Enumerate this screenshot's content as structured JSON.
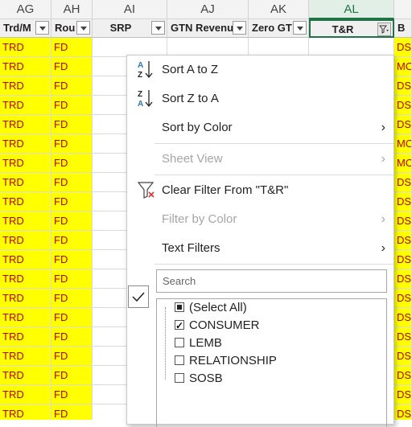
{
  "columns": [
    {
      "letter": "AG",
      "header": "Trd/M"
    },
    {
      "letter": "AH",
      "header": "Rou"
    },
    {
      "letter": "AI",
      "header": "SRP"
    },
    {
      "letter": "AJ",
      "header": "GTN Revenu"
    },
    {
      "letter": "AK",
      "header": "Zero GT"
    },
    {
      "letter": "AL",
      "header": "T&R"
    },
    {
      "letter": "",
      "header": "B"
    }
  ],
  "rows": [
    {
      "ag": "TRD",
      "ah": "FD",
      "am": "DSK"
    },
    {
      "ag": "TRD",
      "ah": "FD",
      "am": "MO"
    },
    {
      "ag": "TRD",
      "ah": "FD",
      "am": "DSK"
    },
    {
      "ag": "TRD",
      "ah": "FD",
      "am": "DSK"
    },
    {
      "ag": "TRD",
      "ah": "FD",
      "am": "DSK"
    },
    {
      "ag": "TRD",
      "ah": "FD",
      "am": "MO"
    },
    {
      "ag": "TRD",
      "ah": "FD",
      "am": "MO"
    },
    {
      "ag": "TRD",
      "ah": "FD",
      "am": "DSK"
    },
    {
      "ag": "TRD",
      "ah": "FD",
      "am": "DSK"
    },
    {
      "ag": "TRD",
      "ah": "FD",
      "am": "DSK"
    },
    {
      "ag": "TRD",
      "ah": "FD",
      "am": "DSK"
    },
    {
      "ag": "TRD",
      "ah": "FD",
      "am": "DSK"
    },
    {
      "ag": "TRD",
      "ah": "FD",
      "am": "DSK"
    },
    {
      "ag": "TRD",
      "ah": "FD",
      "am": "DSK"
    },
    {
      "ag": "TRD",
      "ah": "FD",
      "am": "DSK"
    },
    {
      "ag": "TRD",
      "ah": "FD",
      "am": "DSK"
    },
    {
      "ag": "TRD",
      "ah": "FD",
      "am": "DSK"
    },
    {
      "ag": "TRD",
      "ah": "FD",
      "am": "DSK"
    },
    {
      "ag": "TRD",
      "ah": "FD",
      "am": "DSK"
    },
    {
      "ag": "TRD",
      "ah": "FD",
      "am": "DSK"
    }
  ],
  "menu": {
    "sort_az": "Sort A to Z",
    "sort_za": "Sort Z to A",
    "sort_color": "Sort by Color",
    "sheet_view": "Sheet View",
    "clear_filter": "Clear Filter From \"T&R\"",
    "filter_color": "Filter by Color",
    "text_filters": "Text Filters",
    "search_placeholder": "Search",
    "items": [
      {
        "label": "(Select All)",
        "state": "partial"
      },
      {
        "label": "CONSUMER",
        "state": "checked"
      },
      {
        "label": "LEMB",
        "state": "unchecked"
      },
      {
        "label": "RELATIONSHIP",
        "state": "unchecked"
      },
      {
        "label": "SOSB",
        "state": "unchecked"
      }
    ]
  },
  "colors": {
    "highlight": "#ffff00",
    "text_red": "#c00000",
    "accent": "#217346"
  }
}
